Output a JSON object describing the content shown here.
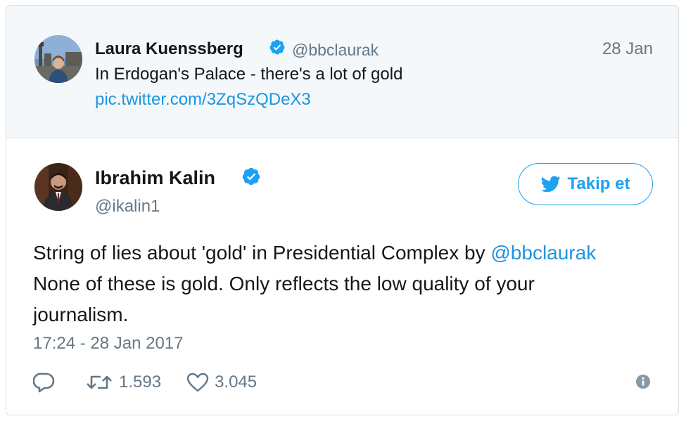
{
  "quoted_tweet": {
    "author_name": "Laura Kuenssberg",
    "handle": "@bbclaurak",
    "date": "28 Jan",
    "text": "In Erdogan's Palace - there's a lot of gold",
    "link": "pic.twitter.com/3ZqSzQDeX3"
  },
  "main_tweet": {
    "author_name": "Ibrahim Kalin",
    "handle": "@ikalin1",
    "follow_label": "Takip et",
    "text_line1_prefix": "String of lies about 'gold' in Presidential Complex by ",
    "text_line1_mention": "@bbclaurak",
    "text_line2": "None of these is gold. Only reflects the low quality of your",
    "text_line3": "journalism.",
    "timestamp": "17:24 - 28 Jan 2017",
    "retweet_count": "1.593",
    "like_count": "3.045"
  },
  "colors": {
    "accent": "#1da1f2",
    "link": "#1b95e0",
    "muted_text": "#657786",
    "quoted_bg": "#f5f8fa"
  },
  "icons": [
    "verified-badge-icon",
    "twitter-bird-icon",
    "reply-icon",
    "retweet-icon",
    "heart-icon",
    "info-icon"
  ]
}
